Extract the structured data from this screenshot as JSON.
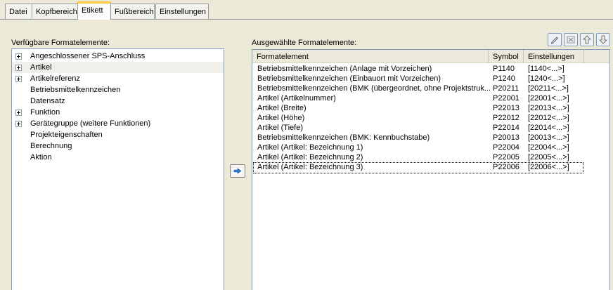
{
  "tabs": [
    {
      "label": "Datei",
      "active": false
    },
    {
      "label": "Kopfbereich",
      "active": false
    },
    {
      "label": "Etikett",
      "active": true
    },
    {
      "label": "Fußbereich",
      "active": false
    },
    {
      "label": "Einstellungen",
      "active": false
    }
  ],
  "left": {
    "title": "Verfügbare Formatelemente:",
    "items": [
      {
        "label": "Angeschlossener SPS-Anschluss",
        "expandable": true
      },
      {
        "label": "Artikel",
        "expandable": true,
        "selected": true
      },
      {
        "label": "Artikelreferenz",
        "expandable": true
      },
      {
        "label": "Betriebsmittelkennzeichen",
        "expandable": false
      },
      {
        "label": "Datensatz",
        "expandable": false
      },
      {
        "label": "Funktion",
        "expandable": true
      },
      {
        "label": "Gerätegruppe (weitere Funktionen)",
        "expandable": true
      },
      {
        "label": "Projekteigenschaften",
        "expandable": false
      },
      {
        "label": "Berechnung",
        "expandable": false
      },
      {
        "label": "Aktion",
        "expandable": false
      }
    ]
  },
  "right": {
    "title": "Ausgewählte Formatelemente:",
    "toolbar": [
      "edit-icon",
      "delete-icon",
      "move-up-icon",
      "move-down-icon"
    ],
    "columns": [
      "Formatelement",
      "Symbol",
      "Einstellungen"
    ],
    "rows": [
      {
        "element": "Betriebsmittelkennzeichen (Anlage mit Vorzeichen)",
        "symbol": "P1140",
        "settings": "[1140<...>]"
      },
      {
        "element": "Betriebsmittelkennzeichen (Einbauort mit Vorzeichen)",
        "symbol": "P1240",
        "settings": "[1240<...>]"
      },
      {
        "element": "Betriebsmittelkennzeichen (BMK (übergeordnet, ohne Projektstruk...",
        "symbol": "P20211",
        "settings": "[20211<...>]"
      },
      {
        "element": "Artikel (Artikelnummer)",
        "symbol": "P22001",
        "settings": "[22001<...>]"
      },
      {
        "element": "Artikel (Breite)",
        "symbol": "P22013",
        "settings": "[22013<...>]"
      },
      {
        "element": "Artikel (Höhe)",
        "symbol": "P22012",
        "settings": "[22012<...>]"
      },
      {
        "element": "Artikel (Tiefe)",
        "symbol": "P22014",
        "settings": "[22014<...>]"
      },
      {
        "element": "Betriebsmittelkennzeichen (BMK: Kennbuchstabe)",
        "symbol": "P20013",
        "settings": "[20013<...>]"
      },
      {
        "element": "Artikel (Artikel: Bezeichnung 1)",
        "symbol": "P22004",
        "settings": "[22004<...>]"
      },
      {
        "element": "Artikel (Artikel: Bezeichnung 2)",
        "symbol": "P22005",
        "settings": "[22005<...>]"
      },
      {
        "element": "Artikel (Artikel: Bezeichnung 3)",
        "symbol": "P22006",
        "settings": "[22006<...>]",
        "focused": true
      }
    ]
  },
  "colors": {
    "background": "#ece9d8",
    "accent": "#ffc83c",
    "transfer_arrow": "#2b7bd9"
  }
}
